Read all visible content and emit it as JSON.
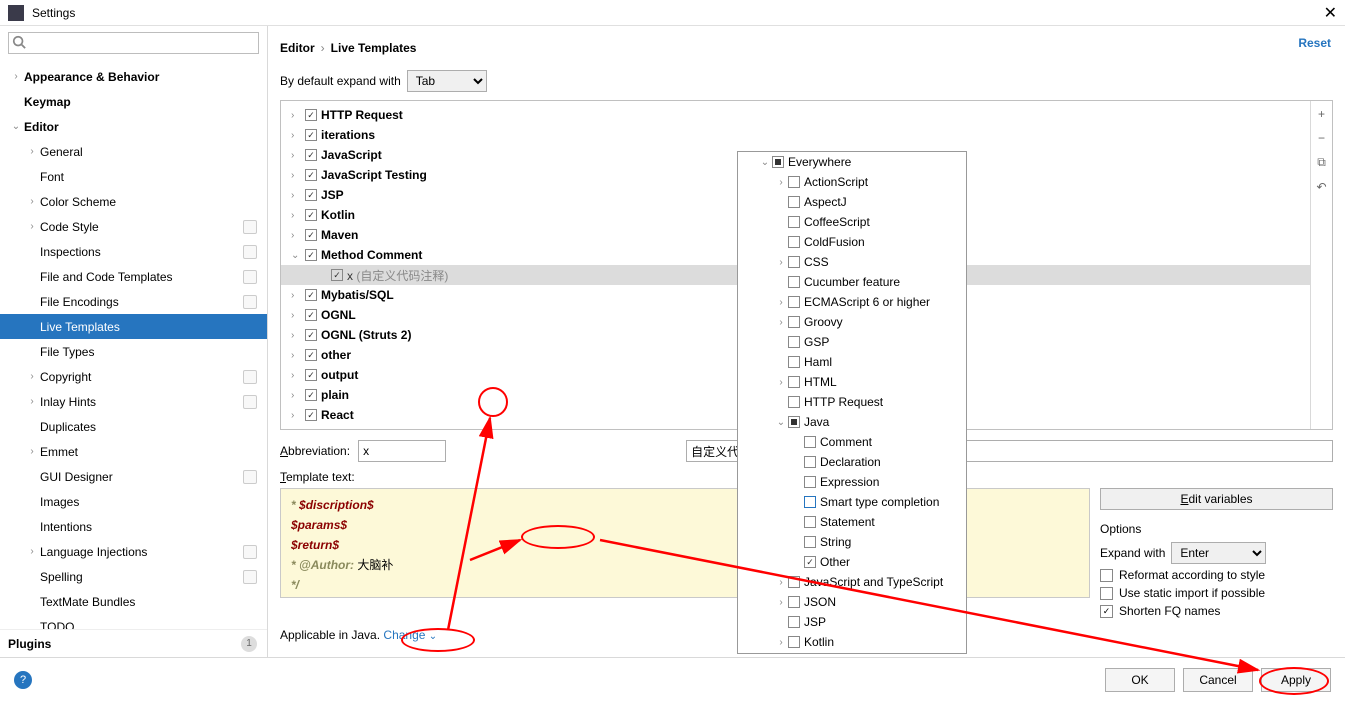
{
  "titlebar": {
    "title": "Settings",
    "close": "✕"
  },
  "reset": "Reset",
  "breadcrumb": {
    "root": "Editor",
    "sep": "›",
    "leaf": "Live Templates"
  },
  "expand": {
    "label": "By default expand with",
    "value": "Tab"
  },
  "sidebar": {
    "items": [
      {
        "label": "Appearance & Behavior",
        "caret": "›",
        "bold": true,
        "indent": 0
      },
      {
        "label": "Keymap",
        "caret": "",
        "bold": true,
        "indent": 0
      },
      {
        "label": "Editor",
        "caret": "⌄",
        "bold": true,
        "indent": 0
      },
      {
        "label": "General",
        "caret": "›",
        "indent": 1
      },
      {
        "label": "Font",
        "caret": "",
        "indent": 1
      },
      {
        "label": "Color Scheme",
        "caret": "›",
        "indent": 1
      },
      {
        "label": "Code Style",
        "caret": "›",
        "indent": 1,
        "badge": true
      },
      {
        "label": "Inspections",
        "caret": "",
        "indent": 1,
        "badge": true
      },
      {
        "label": "File and Code Templates",
        "caret": "",
        "indent": 1,
        "badge": true
      },
      {
        "label": "File Encodings",
        "caret": "",
        "indent": 1,
        "badge": true
      },
      {
        "label": "Live Templates",
        "caret": "",
        "indent": 1,
        "selected": true
      },
      {
        "label": "File Types",
        "caret": "",
        "indent": 1
      },
      {
        "label": "Copyright",
        "caret": "›",
        "indent": 1,
        "badge": true
      },
      {
        "label": "Inlay Hints",
        "caret": "›",
        "indent": 1,
        "badge": true
      },
      {
        "label": "Duplicates",
        "caret": "",
        "indent": 1
      },
      {
        "label": "Emmet",
        "caret": "›",
        "indent": 1
      },
      {
        "label": "GUI Designer",
        "caret": "",
        "indent": 1,
        "badge": true
      },
      {
        "label": "Images",
        "caret": "",
        "indent": 1
      },
      {
        "label": "Intentions",
        "caret": "",
        "indent": 1
      },
      {
        "label": "Language Injections",
        "caret": "›",
        "indent": 1,
        "badge": true
      },
      {
        "label": "Spelling",
        "caret": "",
        "indent": 1,
        "badge": true
      },
      {
        "label": "TextMate Bundles",
        "caret": "",
        "indent": 1
      },
      {
        "label": "TODO",
        "caret": "",
        "indent": 1
      }
    ],
    "plugins": "Plugins",
    "plugins_count": "1"
  },
  "templates": [
    {
      "caret": "›",
      "label": "HTTP Request"
    },
    {
      "caret": "›",
      "label": "iterations"
    },
    {
      "caret": "›",
      "label": "JavaScript"
    },
    {
      "caret": "›",
      "label": "JavaScript Testing"
    },
    {
      "caret": "›",
      "label": "JSP"
    },
    {
      "caret": "›",
      "label": "Kotlin"
    },
    {
      "caret": "›",
      "label": "Maven"
    },
    {
      "caret": "⌄",
      "label": "Method Comment"
    },
    {
      "caret": "",
      "label": "x",
      "desc": "(自定义代码注释)",
      "sub": true,
      "sel": true
    },
    {
      "caret": "›",
      "label": "Mybatis/SQL"
    },
    {
      "caret": "›",
      "label": "OGNL"
    },
    {
      "caret": "›",
      "label": "OGNL (Struts 2)"
    },
    {
      "caret": "›",
      "label": "other"
    },
    {
      "caret": "›",
      "label": "output"
    },
    {
      "caret": "›",
      "label": "plain"
    },
    {
      "caret": "›",
      "label": "React"
    }
  ],
  "toolbar": {
    "add": "+",
    "remove": "−",
    "copy": "⧉",
    "undo": "↶"
  },
  "popup": {
    "root": "Everywhere",
    "items": [
      {
        "label": "ActionScript",
        "caret": "›",
        "indent": 2
      },
      {
        "label": "AspectJ",
        "indent": 2
      },
      {
        "label": "CoffeeScript",
        "indent": 2
      },
      {
        "label": "ColdFusion",
        "indent": 2
      },
      {
        "label": "CSS",
        "caret": "›",
        "indent": 2
      },
      {
        "label": "Cucumber feature",
        "indent": 2
      },
      {
        "label": "ECMAScript 6 or higher",
        "caret": "›",
        "indent": 2
      },
      {
        "label": "Groovy",
        "caret": "›",
        "indent": 2
      },
      {
        "label": "GSP",
        "indent": 2
      },
      {
        "label": "Haml",
        "indent": 2
      },
      {
        "label": "HTML",
        "caret": "›",
        "indent": 2
      },
      {
        "label": "HTTP Request",
        "indent": 2
      },
      {
        "label": "Java",
        "caret": "⌄",
        "indent": 2,
        "half": true,
        "circled": true
      },
      {
        "label": "Comment",
        "indent": 3
      },
      {
        "label": "Declaration",
        "indent": 3
      },
      {
        "label": "Expression",
        "indent": 3
      },
      {
        "label": "Smart type completion",
        "indent": 3,
        "blue": true
      },
      {
        "label": "Statement",
        "indent": 3
      },
      {
        "label": "String",
        "indent": 3
      },
      {
        "label": "Other",
        "indent": 3,
        "checked": true,
        "circled": true
      },
      {
        "label": "JavaScript and TypeScript",
        "caret": "›",
        "indent": 2
      },
      {
        "label": "JSON",
        "caret": "›",
        "indent": 2
      },
      {
        "label": "JSP",
        "indent": 2
      },
      {
        "label": "Kotlin",
        "caret": "›",
        "indent": 2
      }
    ]
  },
  "abbr": {
    "label": "Abbreviation:",
    "value": "x",
    "desc": "自定义代码注释"
  },
  "tt_label": "Template text:",
  "code": {
    "l1a": " * ",
    "l1b": "$discription$",
    "l2": "$params$",
    "l3": "$return$",
    "l4a": " * @Author: ",
    "l4b": "大脑补",
    "l5": " */"
  },
  "edit_vars": "Edit variables",
  "options": {
    "title": "Options",
    "expand_label": "Expand with",
    "expand_value": "Enter",
    "reformat": "Reformat according to style",
    "static_import": "Use static import if possible",
    "shorten_fq": "Shorten FQ names"
  },
  "applicable": {
    "text": "Applicable in Java.",
    "change": "Change"
  },
  "buttons": {
    "ok": "OK",
    "cancel": "Cancel",
    "apply": "Apply"
  }
}
